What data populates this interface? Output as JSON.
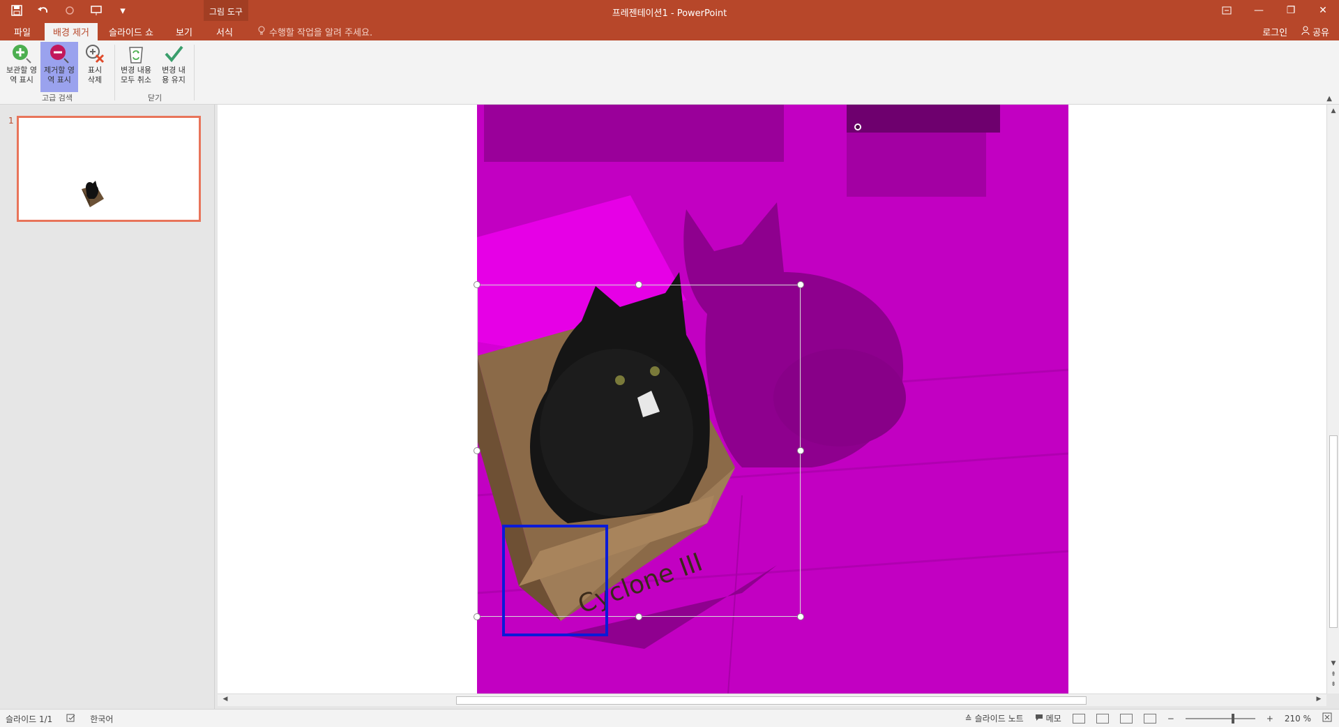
{
  "qat": {
    "save": "save-icon",
    "undo": "undo-icon",
    "redo": "redo-icon",
    "present": "present-icon",
    "customize": "customize-icon"
  },
  "tools_context": "그림 도구",
  "title": "프레젠테이션1 - PowerPoint",
  "tabs": [
    "파일",
    "배경 제거",
    "슬라이드 쇼",
    "보기",
    "서식"
  ],
  "active_tab": "배경 제거",
  "tellme": "수행할 작업을 알려 주세요.",
  "account": {
    "login": "로그인",
    "share": "공유"
  },
  "ribbon": {
    "groups": [
      {
        "label": "고급 검색",
        "buttons": [
          {
            "label1": "보관할 영",
            "label2": "역 표시",
            "icon": "plus-circle-icon"
          },
          {
            "label1": "제거할 영",
            "label2": "역 표시",
            "icon": "minus-circle-icon",
            "selected": true
          },
          {
            "label1": "표시",
            "label2": "삭제",
            "icon": "delete-mark-icon"
          }
        ]
      },
      {
        "label": "닫기",
        "buttons": [
          {
            "label1": "변경 내용",
            "label2": "모두 취소",
            "icon": "trash-icon"
          },
          {
            "label1": "변경 내",
            "label2": "용 유지",
            "icon": "checkmark-icon"
          }
        ]
      }
    ]
  },
  "slides": {
    "current_number": "1"
  },
  "status": {
    "slide": "슬라이드 1/1",
    "language": "한국어",
    "notes": "슬라이드 노트",
    "comments": "메모",
    "zoom": "210 %"
  },
  "colors": {
    "accent": "#b7472a",
    "remove_overlay": "#c200c2",
    "mark_box": "#0a1bd8"
  }
}
